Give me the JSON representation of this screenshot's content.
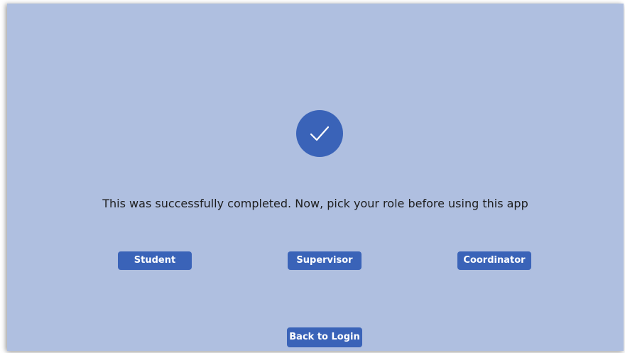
{
  "success": {
    "icon": "checkmark-icon",
    "message": "This was successfully completed. Now, pick your role before using this app"
  },
  "roles": {
    "student_label": "Student",
    "supervisor_label": "Supervisor",
    "coordinator_label": "Coordinator"
  },
  "navigation": {
    "back_label": "Back to Login"
  },
  "colors": {
    "background": "#afbfe0",
    "accent": "#3a63b8",
    "button_text": "#ffffff"
  }
}
